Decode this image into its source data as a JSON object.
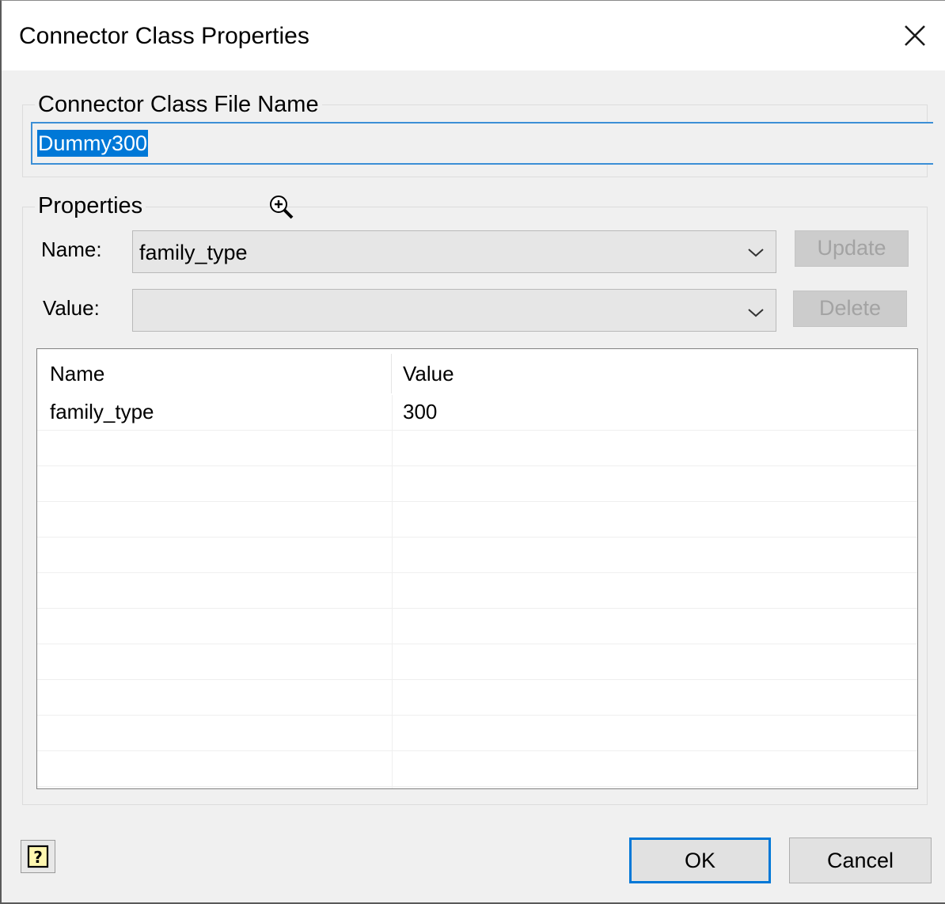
{
  "window": {
    "title": "Connector Class Properties"
  },
  "file_group": {
    "legend": "Connector Class File Name",
    "filename_value": "Dummy300"
  },
  "properties_group": {
    "legend": "Properties",
    "name_label": "Name:",
    "name_selected": "family_type",
    "value_label": "Value:",
    "value_selected": "",
    "update_label": "Update",
    "delete_label": "Delete"
  },
  "table": {
    "columns": [
      "Name",
      "Value"
    ],
    "rows": [
      {
        "name": "family_type",
        "value": "300"
      },
      {
        "name": "",
        "value": ""
      },
      {
        "name": "",
        "value": ""
      },
      {
        "name": "",
        "value": ""
      },
      {
        "name": "",
        "value": ""
      },
      {
        "name": "",
        "value": ""
      },
      {
        "name": "",
        "value": ""
      },
      {
        "name": "",
        "value": ""
      },
      {
        "name": "",
        "value": ""
      },
      {
        "name": "",
        "value": ""
      },
      {
        "name": "",
        "value": ""
      }
    ]
  },
  "footer": {
    "ok_label": "OK",
    "cancel_label": "Cancel",
    "help_icon": "help-icon"
  },
  "colors": {
    "accent": "#0078d7",
    "dialog_bg": "#f0f0f0",
    "disabled_bg": "#cccccc"
  }
}
